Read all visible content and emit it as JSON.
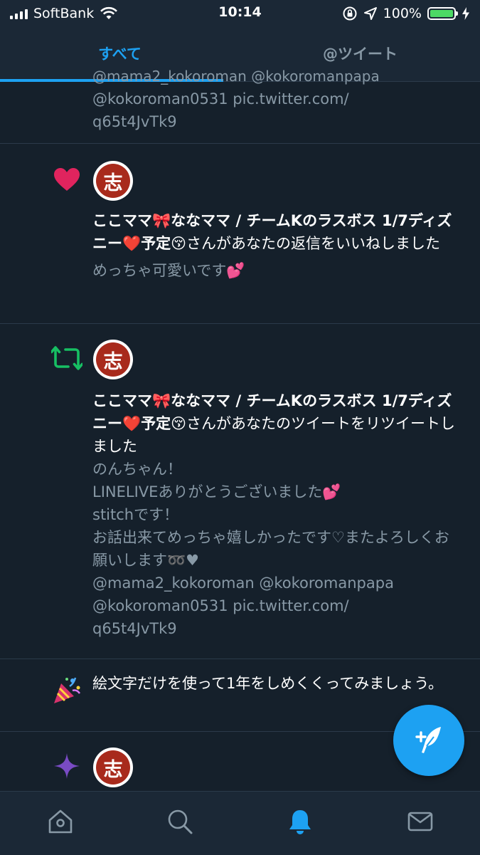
{
  "status_bar": {
    "carrier": "SoftBank",
    "time": "10:14",
    "battery": "100%",
    "battery_level": 1.0
  },
  "tabs": [
    {
      "label": "すべて",
      "active": true
    },
    {
      "label": "@ツイート",
      "active": false
    }
  ],
  "partial_item": {
    "cut_line": "@mama2_kokoroman @kokoromanpapa",
    "lines": [
      "@kokoroman0531 pic.twitter.com/",
      "q65t4JvTk9"
    ]
  },
  "notifications": [
    {
      "type": "like",
      "icon": "heart-icon",
      "avatar_char": "志",
      "actor": "ここママ🎀ななママ / チームKのラスボス 1/7ディズニー❤️予定😚",
      "action": "さんがあなたの返信をいいねしました",
      "tweet": "めっちゃ可愛いです💕"
    },
    {
      "type": "retweet",
      "icon": "retweet-icon",
      "avatar_char": "志",
      "actor": "ここママ🎀ななママ / チームKのラスボス 1/7ディズニー❤️予定😚",
      "action": "さんがあなたのツイートをリツイートしました",
      "tweet": "のんちゃん！\nLINELIVEありがとうございました💕\nstitchです！\nお話出来てめっちゃ嬉しかったです♡またよろしくお願いします➿♥\n@mama2_kokoroman @kokoromanpapa\n@kokoroman0531 pic.twitter.com/\nq65t4JvTk9"
    }
  ],
  "promo": {
    "icon": "party-popper-icon",
    "text": "絵文字だけを使って1年をしめくくってみましょう。"
  },
  "last_item": {
    "icon": "sparkle-icon",
    "avatar_char": "志"
  },
  "fab": {
    "icon": "compose-tweet-icon"
  },
  "bottom_nav": [
    {
      "name": "home-icon",
      "active": false
    },
    {
      "name": "search-icon",
      "active": false
    },
    {
      "name": "notifications-icon",
      "active": true
    },
    {
      "name": "messages-icon",
      "active": false
    }
  ],
  "colors": {
    "background": "#15202b",
    "bar": "#1b2836",
    "accent": "#1da1f2",
    "muted": "#8899a6",
    "like": "#e0245e",
    "retweet": "#17bf63",
    "sparkle": "#794bc4"
  }
}
